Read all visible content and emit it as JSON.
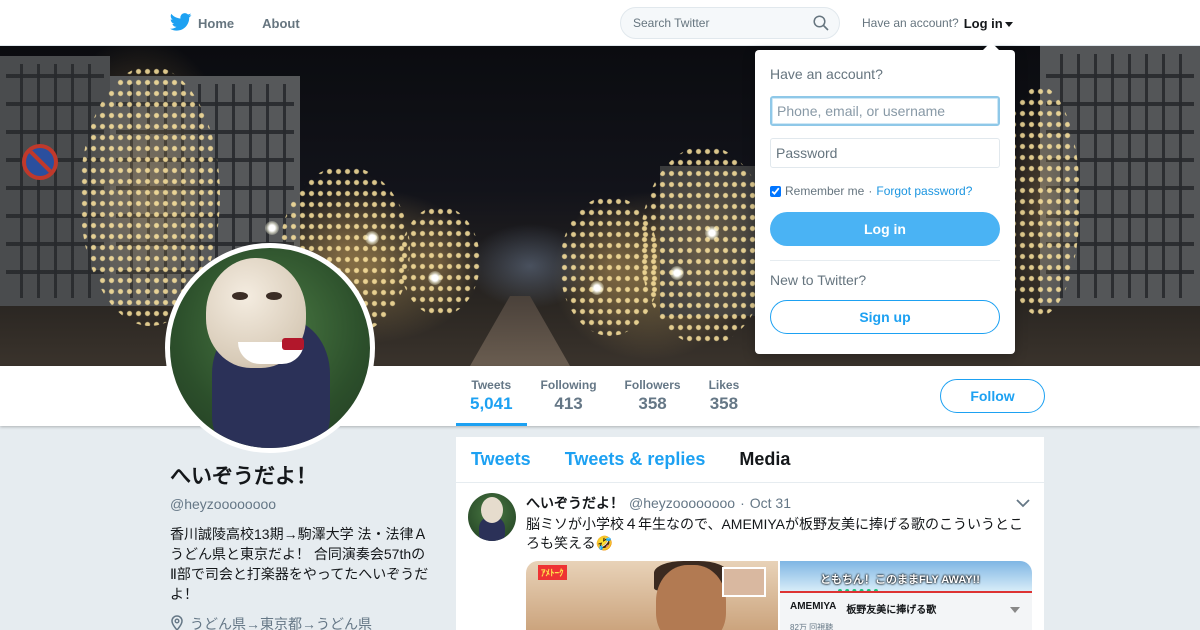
{
  "nav": {
    "home_label": "Home",
    "about_label": "About",
    "search_placeholder": "Search Twitter",
    "have_account": "Have an account?",
    "login_label": "Log in"
  },
  "colors": {
    "brand": "#1da1f2",
    "login_button": "#4ab3f4"
  },
  "icons": {
    "logo": "twitter-bird-icon",
    "search": "search-icon",
    "caret": "caret-down-icon",
    "location": "location-pin-icon"
  },
  "login_dropdown": {
    "title": "Have an account?",
    "username_placeholder": "Phone, email, or username",
    "password_placeholder": "Password",
    "remember_label": "Remember me",
    "separator": "·",
    "forgot_label": "Forgot password?",
    "remember_checked": true,
    "login_button": "Log in",
    "new_prompt": "New to Twitter?",
    "signup_button": "Sign up"
  },
  "profile_nav": {
    "stats": [
      {
        "label": "Tweets",
        "value": "5,041"
      },
      {
        "label": "Following",
        "value": "413"
      },
      {
        "label": "Followers",
        "value": "358"
      },
      {
        "label": "Likes",
        "value": "358"
      }
    ],
    "follow_label": "Follow"
  },
  "profile": {
    "name": "へいぞうだよ！",
    "handle": "@heyzoooooooo",
    "bio": "香川誠陵高校13期→駒澤大学 法・法律Ａ　　　　うどん県と東京だよ！ 合同演奏会57thのⅡ部で司会と打楽器をやってたへいぞうだよ！",
    "location": "うどん県→東京都→うどん県"
  },
  "timeline": {
    "tabs": [
      "Tweets",
      "Tweets & replies",
      "Media"
    ],
    "tweet": {
      "name": "へいぞうだよ！",
      "handle": "@heyzoooooooo",
      "separator": "·",
      "time": "Oct 31",
      "text": "脳ミソが小学校４年生なので、AMEMIYAが板野友美に捧げる歌のこういうところも笑える🤣",
      "media": {
        "left_logo": "ｱﾒﾄｰｸ",
        "right_caption": "ともちん！このままFLY AWAY!!",
        "right_title_artist": "AMEMIYA",
        "right_title_song": "板野友美に捧げる歌",
        "right_views": "82万 回視聴"
      }
    }
  }
}
